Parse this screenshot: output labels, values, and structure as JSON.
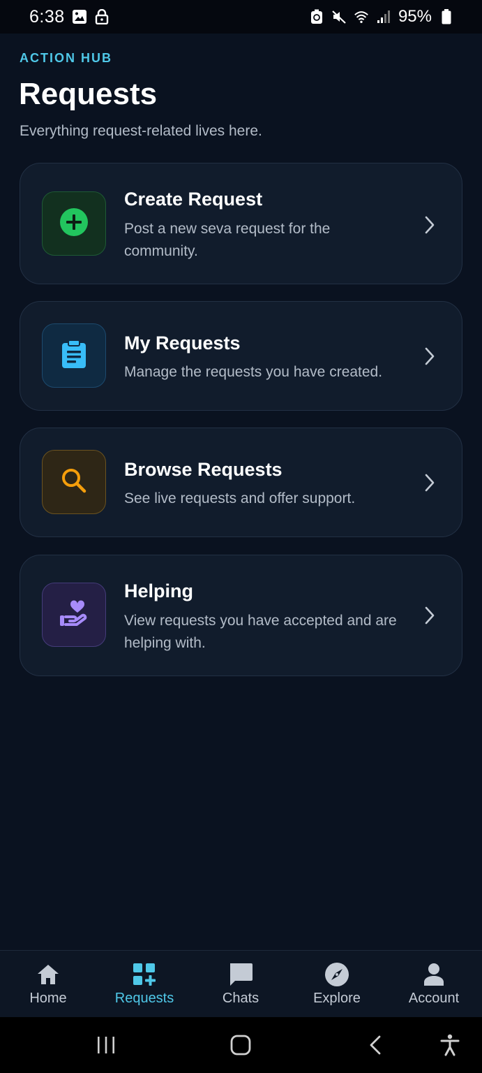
{
  "status_bar": {
    "time": "6:38",
    "battery": "95%"
  },
  "header": {
    "eyebrow": "ACTION HUB",
    "title": "Requests",
    "subtitle": "Everything request-related lives here."
  },
  "cards": [
    {
      "title": "Create Request",
      "description": "Post a new seva request for the community.",
      "icon": "add-circle-icon",
      "accent": "#22c55e"
    },
    {
      "title": "My Requests",
      "description": "Manage the requests you have created.",
      "icon": "clipboard-icon",
      "accent": "#38bdf8"
    },
    {
      "title": "Browse Requests",
      "description": "See live requests and offer support.",
      "icon": "search-icon",
      "accent": "#f59e0b"
    },
    {
      "title": "Helping",
      "description": "View requests you have accepted and are helping with.",
      "icon": "helping-hand-heart-icon",
      "accent": "#a78bfa"
    }
  ],
  "bottom_nav": {
    "items": [
      {
        "label": "Home",
        "icon": "home-icon"
      },
      {
        "label": "Requests",
        "icon": "grid-plus-icon",
        "active": true
      },
      {
        "label": "Chats",
        "icon": "chat-icon"
      },
      {
        "label": "Explore",
        "icon": "compass-icon"
      },
      {
        "label": "Account",
        "icon": "account-icon"
      }
    ]
  },
  "colors": {
    "background": "#0a1220",
    "card": "#111c2c",
    "accent": "#4fc8e8",
    "text_secondary": "#b3bcc8"
  }
}
